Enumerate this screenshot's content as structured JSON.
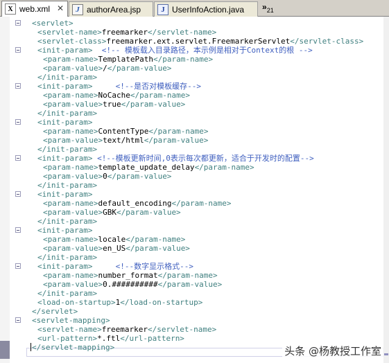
{
  "tabs": [
    {
      "label": "web.xml",
      "type": "xml",
      "active": true
    },
    {
      "label": "authorArea.jsp",
      "type": "jsp",
      "active": false
    },
    {
      "label": "UserInfoAction.java",
      "type": "java",
      "active": false
    }
  ],
  "overflow": {
    "chevron": "»",
    "count": "21"
  },
  "code_lines": [
    [
      [
        "t",
        "<servlet>"
      ]
    ],
    [
      [
        "t",
        "<servlet-name>"
      ],
      [
        "x",
        "freemarker"
      ],
      [
        "t",
        "</servlet-name>"
      ]
    ],
    [
      [
        "t",
        "<servlet-class>"
      ],
      [
        "x",
        "freemarker.ext.servlet.FreemarkerServlet"
      ],
      [
        "t",
        "</servlet-class>"
      ]
    ],
    [
      [
        "t",
        "<init-param>"
      ],
      [
        "x",
        "  "
      ],
      [
        "c",
        "<!-- 模板载入目录路径，本示例是相对于Context的根 -->"
      ]
    ],
    [
      [
        "t",
        "<param-name>"
      ],
      [
        "x",
        "TemplatePath"
      ],
      [
        "t",
        "</param-name>"
      ]
    ],
    [
      [
        "t",
        "<param-value>"
      ],
      [
        "x",
        "/"
      ],
      [
        "t",
        "</param-value>"
      ]
    ],
    [
      [
        "t",
        "</init-param>"
      ]
    ],
    [
      [
        "t",
        "<init-param>"
      ],
      [
        "x",
        "     "
      ],
      [
        "c",
        "<!--是否对模板缓存-->"
      ]
    ],
    [
      [
        "t",
        "<param-name>"
      ],
      [
        "x",
        "NoCache"
      ],
      [
        "t",
        "</param-name>"
      ]
    ],
    [
      [
        "t",
        "<param-value>"
      ],
      [
        "x",
        "true"
      ],
      [
        "t",
        "</param-value>"
      ]
    ],
    [
      [
        "t",
        "</init-param>"
      ]
    ],
    [
      [
        "t",
        "<init-param>"
      ]
    ],
    [
      [
        "t",
        "<param-name>"
      ],
      [
        "x",
        "ContentType"
      ],
      [
        "t",
        "</param-name>"
      ]
    ],
    [
      [
        "t",
        "<param-value>"
      ],
      [
        "x",
        "text/html"
      ],
      [
        "t",
        "</param-value>"
      ]
    ],
    [
      [
        "t",
        "</init-param>"
      ]
    ],
    [
      [
        "t",
        "<init-param>"
      ],
      [
        "x",
        " "
      ],
      [
        "c",
        "<!--模板更新时间,0表示每次都更新，适合于开发时的配置-->"
      ]
    ],
    [
      [
        "t",
        "<param-name>"
      ],
      [
        "x",
        "template_update_delay"
      ],
      [
        "t",
        "</param-name>"
      ]
    ],
    [
      [
        "t",
        "<param-value>"
      ],
      [
        "x",
        "0"
      ],
      [
        "t",
        "</param-value>"
      ]
    ],
    [
      [
        "t",
        "</init-param>"
      ]
    ],
    [
      [
        "t",
        "<init-param>"
      ]
    ],
    [
      [
        "t",
        "<param-name>"
      ],
      [
        "x",
        "default_encoding"
      ],
      [
        "t",
        "</param-name>"
      ]
    ],
    [
      [
        "t",
        "<param-value>"
      ],
      [
        "x",
        "GBK"
      ],
      [
        "t",
        "</param-value>"
      ]
    ],
    [
      [
        "t",
        "</init-param>"
      ]
    ],
    [
      [
        "t",
        "<init-param>"
      ]
    ],
    [
      [
        "t",
        "<param-name>"
      ],
      [
        "x",
        "locale"
      ],
      [
        "t",
        "</param-name>"
      ]
    ],
    [
      [
        "t",
        "<param-value>"
      ],
      [
        "x",
        "en_US"
      ],
      [
        "t",
        "</param-value>"
      ]
    ],
    [
      [
        "t",
        "</init-param>"
      ]
    ],
    [
      [
        "t",
        "<init-param>"
      ],
      [
        "x",
        "     "
      ],
      [
        "c",
        "<!--数字显示格式-->"
      ]
    ],
    [
      [
        "t",
        "<param-name>"
      ],
      [
        "x",
        "number_format"
      ],
      [
        "t",
        "</param-name>"
      ]
    ],
    [
      [
        "t",
        "<param-value>"
      ],
      [
        "x",
        "0.##########"
      ],
      [
        "t",
        "</param-value>"
      ]
    ],
    [
      [
        "t",
        "</init-param>"
      ]
    ],
    [
      [
        "t",
        "<load-on-startup>"
      ],
      [
        "x",
        "1"
      ],
      [
        "t",
        "</load-on-startup>"
      ]
    ],
    [
      [
        "t",
        "</servlet>"
      ]
    ],
    [
      [
        "t",
        "<servlet-mapping>"
      ]
    ],
    [
      [
        "t",
        "<servlet-name>"
      ],
      [
        "x",
        "freemarker"
      ],
      [
        "t",
        "</servlet-name>"
      ]
    ],
    [
      [
        "t",
        "<url-pattern>"
      ],
      [
        "x",
        "*.ftl"
      ],
      [
        "t",
        "</url-pattern>"
      ]
    ],
    [
      [
        "t",
        "</servlet-mapping>"
      ]
    ]
  ],
  "indents": [
    0,
    1,
    1,
    1,
    2,
    2,
    1,
    1,
    2,
    2,
    1,
    1,
    2,
    2,
    1,
    1,
    2,
    2,
    1,
    1,
    2,
    2,
    1,
    1,
    2,
    2,
    1,
    1,
    2,
    2,
    1,
    1,
    0,
    0,
    1,
    1,
    0
  ],
  "fold_lines": [
    0,
    3,
    7,
    11,
    15,
    19,
    23,
    27,
    33
  ],
  "colors": {
    "tag": "#3f7f7f",
    "text": "#000000",
    "comment": "#3f5fbf",
    "tab_bg": "#d4d0c8",
    "accent": "#9090c0"
  },
  "watermark": "头条 @杨教授工作室"
}
